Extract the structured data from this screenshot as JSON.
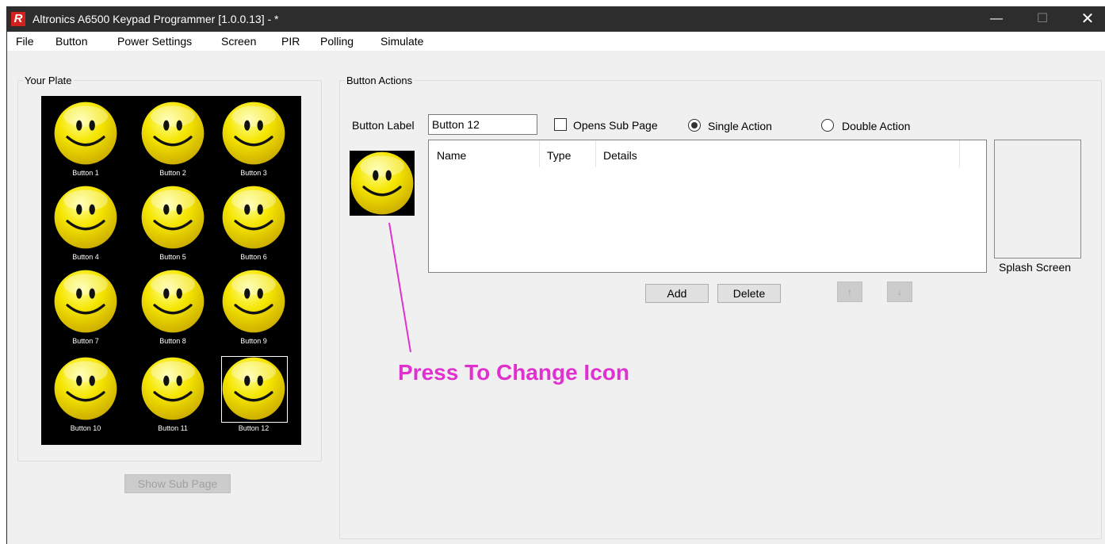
{
  "window": {
    "title": "Altronics A6500 Keypad Programmer [1.0.0.13]  - *",
    "app_icon_letter": "R",
    "controls": {
      "minimize": "—",
      "maximize": "☐",
      "close": "✕"
    }
  },
  "menu": [
    "File",
    "Button",
    "Power Settings",
    "Screen",
    "PIR",
    "Polling",
    "Simulate"
  ],
  "your_plate": {
    "legend": "Your Plate",
    "buttons": [
      "Button 1",
      "Button 2",
      "Button 3",
      "Button 4",
      "Button 5",
      "Button 6",
      "Button 7",
      "Button 8",
      "Button 9",
      "Button 10",
      "Button 11",
      "Button 12"
    ],
    "selected": "Button 12",
    "show_sub_page": "Show Sub Page"
  },
  "button_actions": {
    "legend": "Button Actions",
    "label_caption": "Button Label",
    "label_value": "Button 12",
    "opens_sub_page": {
      "label": "Opens Sub Page",
      "checked": false
    },
    "single_action": {
      "label": "Single Action",
      "checked": true
    },
    "double_action": {
      "label": "Double Action",
      "checked": false
    },
    "columns": [
      "Name",
      "Type",
      "Details"
    ],
    "add": "Add",
    "delete": "Delete",
    "move_up": "↑",
    "move_down": "↓",
    "splash_screen": "Splash Screen"
  },
  "annotation": {
    "text": "Press To Change Icon",
    "color": "#e030d0"
  },
  "colors": {
    "titlebar": "#2d2d2d",
    "window_bg": "#f0f0f0",
    "plate_bg": "#000000",
    "smiley": "#f5e600",
    "annotation": "#e030d0"
  }
}
